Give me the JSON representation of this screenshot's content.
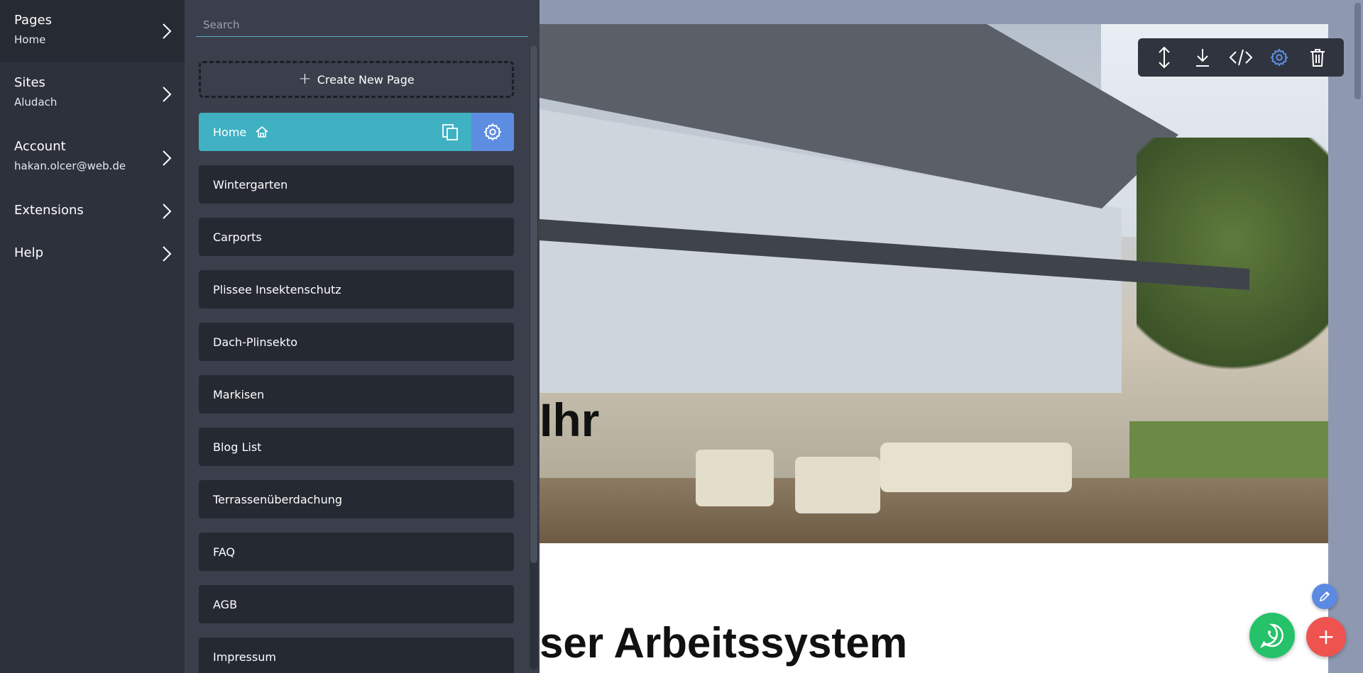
{
  "nav": {
    "items": [
      {
        "title": "Pages",
        "subtitle": "Home"
      },
      {
        "title": "Sites",
        "subtitle": "Aludach"
      },
      {
        "title": "Account",
        "subtitle": "hakan.olcer@web.de"
      },
      {
        "title": "Extensions",
        "subtitle": ""
      },
      {
        "title": "Help",
        "subtitle": ""
      }
    ]
  },
  "pages_panel": {
    "search_placeholder": "Search",
    "create_label": "Create New Page",
    "pages": [
      "Home",
      "Wintergarten",
      "Carports",
      "Plissee Insektenschutz",
      "Dach-Plinsekto",
      "Markisen",
      "Blog List",
      "Terrassenüberdachung",
      "FAQ",
      "AGB",
      "Impressum"
    ]
  },
  "preview": {
    "hero_title": "Ihr",
    "section_title": "ser Arbeitssystem"
  },
  "colors": {
    "nav_bg": "#2d313c",
    "panel_bg": "#3a3f4b",
    "page_item_bg": "#252932",
    "active_page": "#3fb1c3",
    "gear_accent": "#5d8de0",
    "whatsapp": "#25c26a",
    "add_fab": "#ef5350"
  },
  "icons": {
    "toolbar": [
      "move-vertical-icon",
      "download-icon",
      "code-icon",
      "gear-icon",
      "trash-icon"
    ]
  }
}
